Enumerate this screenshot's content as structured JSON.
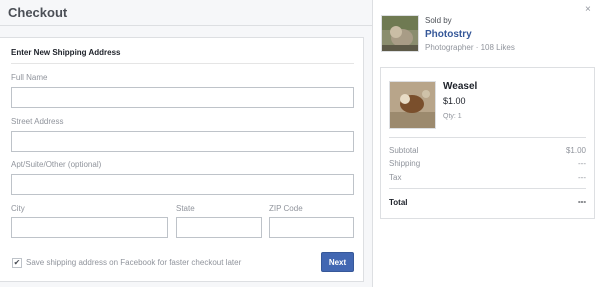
{
  "header": {
    "title": "Checkout"
  },
  "form": {
    "heading": "Enter New Shipping Address",
    "full_name": {
      "label": "Full Name",
      "value": ""
    },
    "street": {
      "label": "Street Address",
      "value": ""
    },
    "apt": {
      "label": "Apt/Suite/Other (optional)",
      "value": ""
    },
    "city": {
      "label": "City",
      "value": ""
    },
    "state": {
      "label": "State",
      "value": ""
    },
    "zip": {
      "label": "ZIP Code",
      "value": ""
    },
    "save_checkbox": {
      "label": "Save shipping address on Facebook for faster checkout later",
      "checked": true,
      "glyph": "✔"
    },
    "next_label": "Next"
  },
  "seller": {
    "sold_by": "Sold by",
    "name": "Photostry",
    "meta": "Photographer · 108 Likes"
  },
  "product": {
    "name": "Weasel",
    "price": "$1.00",
    "qty": "Qty: 1"
  },
  "summary": {
    "subtotal_label": "Subtotal",
    "subtotal_value": "$1.00",
    "shipping_label": "Shipping",
    "shipping_value": "---",
    "tax_label": "Tax",
    "tax_value": "---",
    "total_label": "Total",
    "total_value": "---"
  },
  "icons": {
    "close": "×"
  },
  "colors": {
    "accent": "#4267b2",
    "link": "#365899",
    "muted": "#90949c"
  }
}
